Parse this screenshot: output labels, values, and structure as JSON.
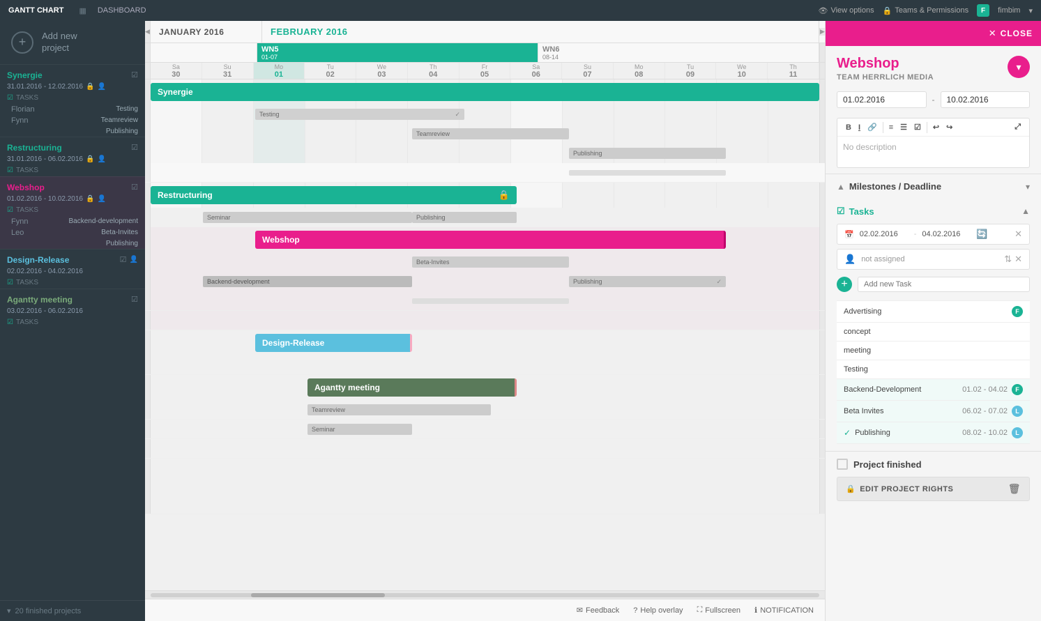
{
  "topbar": {
    "brand": "GANTT CHART",
    "dashboard": "DASHBOARD",
    "view_options": "View options",
    "teams_permissions": "Teams & Permissions",
    "user": "fimbim",
    "user_initial": "F"
  },
  "sidebar": {
    "add_project_label": "Add new\nproject",
    "projects": [
      {
        "id": "synergie",
        "name": "Synergie",
        "dates": "31.01.2016 - 12.02.2016",
        "color": "#1ab394",
        "tasks_label": "TASKS",
        "members": [
          {
            "name": "Florian",
            "task": "Testing"
          },
          {
            "name": "Fynn",
            "task": "Teamreview"
          },
          {
            "name": "",
            "task": "Publishing"
          }
        ]
      },
      {
        "id": "restructuring",
        "name": "Restructuring",
        "dates": "31.01.2016 - 06.02.2016",
        "color": "#1ab394",
        "tasks_label": "TASKS"
      },
      {
        "id": "webshop",
        "name": "Webshop",
        "dates": "01.02.2016 - 10.02.2016",
        "color": "#e91e8c",
        "tasks_label": "TASKS",
        "members": [
          {
            "name": "Fynn",
            "task": "Backend-development"
          },
          {
            "name": "Leo",
            "task": "Beta-Invites"
          },
          {
            "name": "",
            "task": "Publishing"
          }
        ]
      },
      {
        "id": "design-release",
        "name": "Design-Release",
        "dates": "02.02.2016 - 04.02.2016",
        "color": "#5bc0de",
        "tasks_label": "TASKS"
      },
      {
        "id": "agantty",
        "name": "Agantty meeting",
        "dates": "03.02.2016 - 06.02.2016",
        "color": "#4a7a54",
        "tasks_label": "TASKS"
      }
    ],
    "footer": "20 finished projects"
  },
  "gantt": {
    "months": [
      {
        "name": "JANUARY 2016",
        "color": "#555"
      },
      {
        "name": "FEBRUARY 2016",
        "color": "#1ab394"
      }
    ],
    "weeks": [
      {
        "label": "WN5",
        "dates": "01-07",
        "active": true
      },
      {
        "label": "WN6",
        "dates": "08-14",
        "active": false
      }
    ],
    "days": [
      {
        "name": "Sa",
        "num": "30"
      },
      {
        "name": "Su",
        "num": "31"
      },
      {
        "name": "Mo",
        "num": "01",
        "today": true
      },
      {
        "name": "Tu",
        "num": "02"
      },
      {
        "name": "We",
        "num": "03"
      },
      {
        "name": "Th",
        "num": "04"
      },
      {
        "name": "Fr",
        "num": "05"
      },
      {
        "name": "Sa",
        "num": "06"
      },
      {
        "name": "Su",
        "num": "07"
      },
      {
        "name": "Mo",
        "num": "08"
      },
      {
        "name": "Tu",
        "num": "09"
      },
      {
        "name": "We",
        "num": "10"
      },
      {
        "name": "Th",
        "num": "11"
      }
    ],
    "projects": [
      {
        "name": "Synergie",
        "color": "#1ab394"
      },
      {
        "name": "Restructuring",
        "color": "#1ab394"
      },
      {
        "name": "Webshop",
        "color": "#e91e8c"
      },
      {
        "name": "Design-Release",
        "color": "#5bc0de"
      },
      {
        "name": "Agantty meeting",
        "color": "#5a7a5a"
      }
    ]
  },
  "right_panel": {
    "close_label": "CLOSE",
    "project_name": "Webshop",
    "team_name": "TEAM HERRLICH MEDIA",
    "start_date": "01.02.2016",
    "end_date": "10.02.2016",
    "description_placeholder": "No description",
    "milestones_title": "Milestones / Deadline",
    "tasks_title": "Tasks",
    "task_start": "02.02.2016",
    "task_end": "04.02.2016",
    "not_assigned": "not assigned",
    "add_task_placeholder": "Add new Task",
    "task_items": [
      {
        "name": "Advertising",
        "user_initial": "F",
        "user_color": "#1ab394",
        "dates": ""
      },
      {
        "name": "concept",
        "user_initial": "",
        "user_color": "",
        "dates": ""
      },
      {
        "name": "meeting",
        "user_initial": "",
        "user_color": "",
        "dates": ""
      },
      {
        "name": "Testing",
        "user_initial": "",
        "user_color": "",
        "dates": ""
      },
      {
        "name": "Backend-Development",
        "user_initial": "F",
        "user_color": "#1ab394",
        "dates": "01.02 - 04.02",
        "checked": false
      },
      {
        "name": "Beta Invites",
        "user_initial": "L",
        "user_color": "#5bc0de",
        "dates": "06.02 - 07.02",
        "checked": false
      },
      {
        "name": "Publishing",
        "user_initial": "L",
        "user_color": "#5bc0de",
        "dates": "08.02 - 10.02",
        "checked": true
      }
    ],
    "project_finished_label": "Project finished",
    "edit_rights_label": "EDIT PROJECT RIGHTS"
  },
  "bottom_bar": {
    "feedback": "Feedback",
    "help_overlay": "Help overlay",
    "fullscreen": "Fullscreen",
    "notification": "NOTIFICATION"
  }
}
